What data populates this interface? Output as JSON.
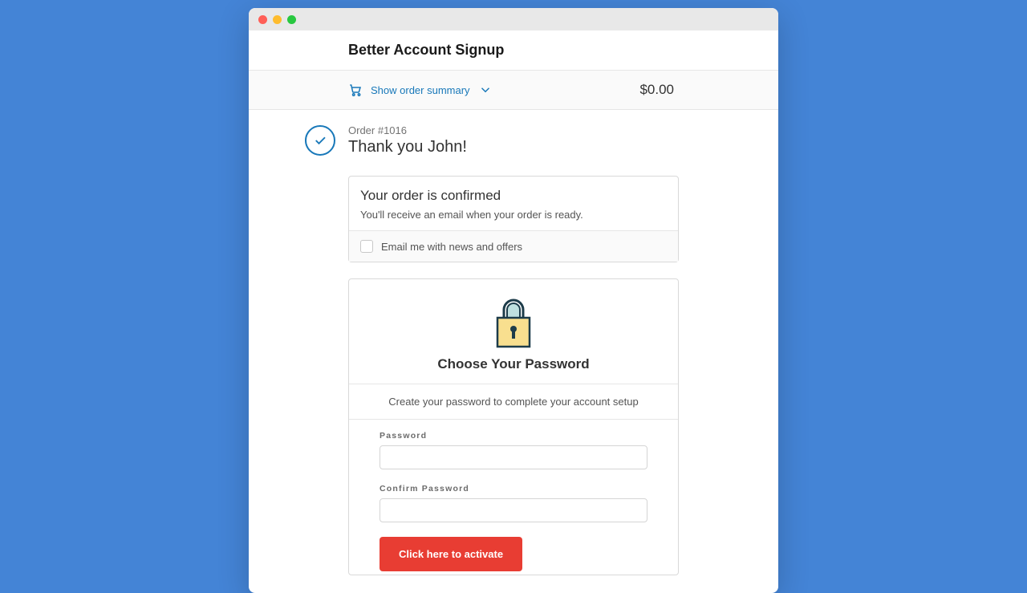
{
  "colors": {
    "page_bg": "#4484d6",
    "link": "#1878b9",
    "danger": "#e83d33"
  },
  "window": {
    "traffic_lights": [
      "close",
      "minimize",
      "maximize"
    ]
  },
  "header": {
    "title": "Better Account Signup"
  },
  "summary": {
    "toggle_label": "Show order summary",
    "total": "$0.00"
  },
  "order": {
    "number_label": "Order #1016",
    "thank_you": "Thank you John!"
  },
  "confirm_card": {
    "title": "Your order is confirmed",
    "subtitle": "You'll receive an email when your order is ready.",
    "newsletter_label": "Email me with news and offers",
    "newsletter_checked": false
  },
  "password_card": {
    "title": "Choose Your Password",
    "subtitle": "Create your password to complete your account setup",
    "password_label": "Password",
    "password_value": "",
    "confirm_label": "Confirm Password",
    "confirm_value": "",
    "button_label": "Click here to activate"
  }
}
